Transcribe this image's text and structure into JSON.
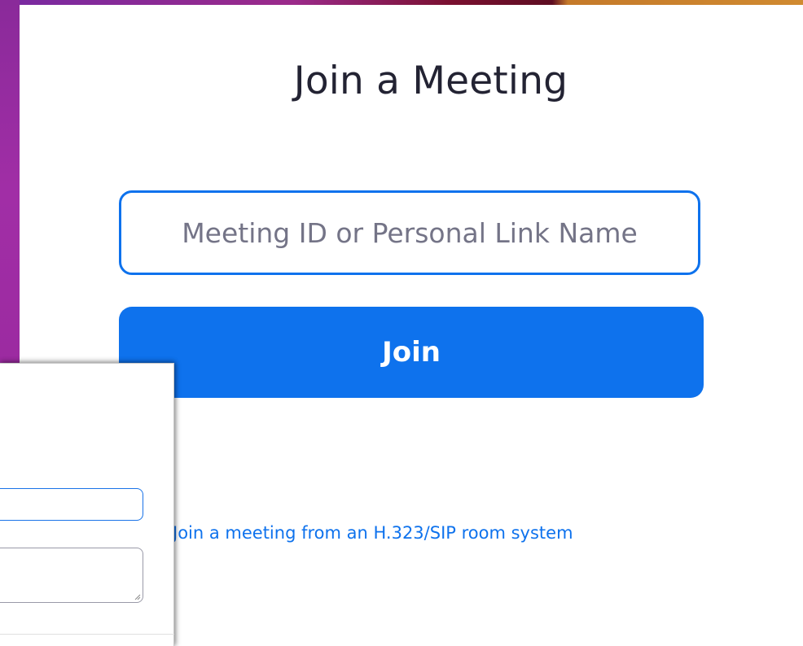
{
  "join_meeting": {
    "title": "Join a Meeting",
    "meeting_input": {
      "placeholder": "Meeting ID or Personal Link Name",
      "value": ""
    },
    "join_button_label": "Join",
    "sip_link_label": "Join a meeting from an H.323/SIP room system"
  },
  "overlay_dialog": {
    "name_field_value": "",
    "message_field_value": ""
  },
  "colors": {
    "accent": "#0e72ed",
    "title_text": "#232333",
    "placeholder_text": "#747487"
  }
}
